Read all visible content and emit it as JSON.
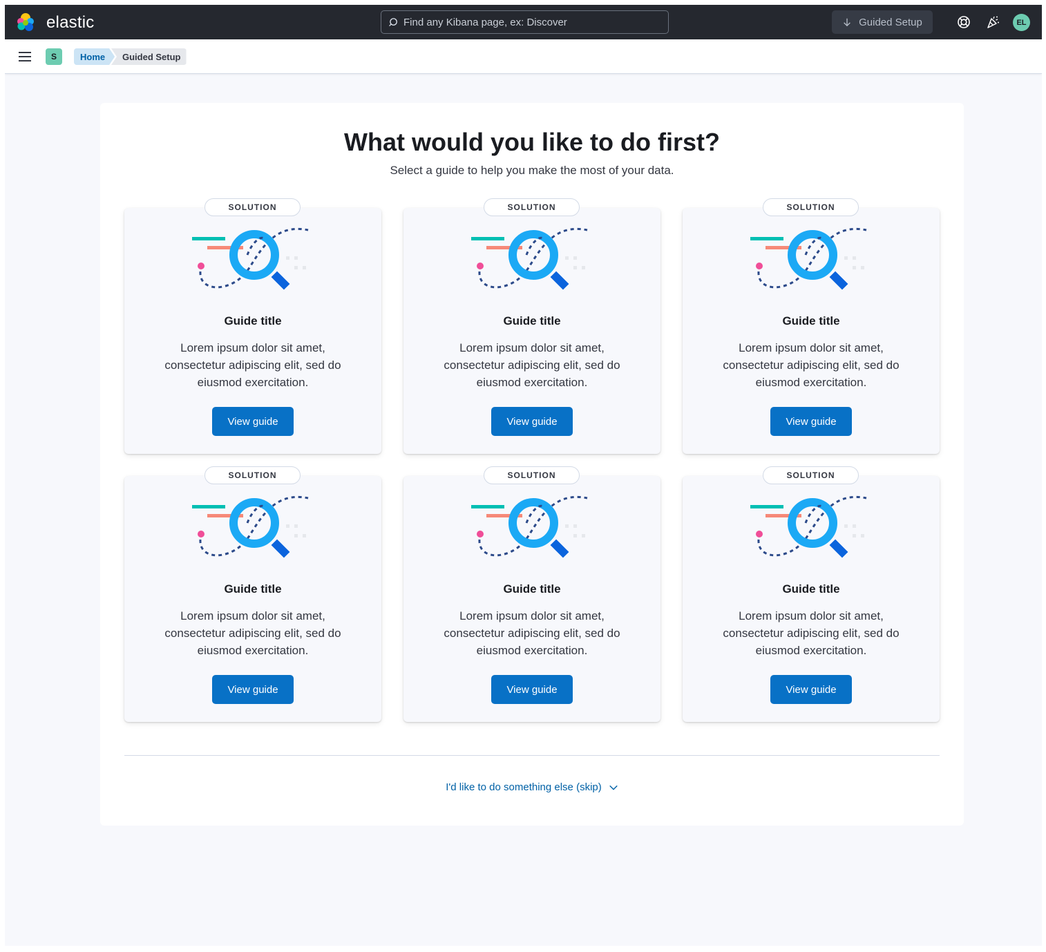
{
  "header": {
    "brand": "elastic",
    "search_placeholder": "Find any Kibana page, ex: Discover",
    "guided_setup_label": "Guided Setup",
    "avatar_initials": "EL"
  },
  "subbar": {
    "space_initial": "S",
    "breadcrumbs": [
      {
        "label": "Home"
      },
      {
        "label": "Guided Setup"
      }
    ]
  },
  "main": {
    "title": "What would you like to do first?",
    "subtitle": "Select a guide to help you make the most of your data.",
    "cards": [
      {
        "badge": "SOLUTION",
        "title": "Guide title",
        "description": "Lorem ipsum dolor sit amet, consectetur adipiscing elit, sed do eiusmod exercitation.",
        "button": "View guide"
      },
      {
        "badge": "SOLUTION",
        "title": "Guide title",
        "description": "Lorem ipsum dolor sit amet, consectetur adipiscing elit, sed do eiusmod exercitation.",
        "button": "View guide"
      },
      {
        "badge": "SOLUTION",
        "title": "Guide title",
        "description": "Lorem ipsum dolor sit amet, consectetur adipiscing elit, sed do eiusmod exercitation.",
        "button": "View guide"
      },
      {
        "badge": "SOLUTION",
        "title": "Guide title",
        "description": "Lorem ipsum dolor sit amet, consectetur adipiscing elit, sed do eiusmod exercitation.",
        "button": "View guide"
      },
      {
        "badge": "SOLUTION",
        "title": "Guide title",
        "description": "Lorem ipsum dolor sit amet, consectetur adipiscing elit, sed do eiusmod exercitation.",
        "button": "View guide"
      },
      {
        "badge": "SOLUTION",
        "title": "Guide title",
        "description": "Lorem ipsum dolor sit amet, consectetur adipiscing elit, sed do eiusmod exercitation.",
        "button": "View guide"
      }
    ],
    "skip_label": "I'd like to do something else (skip)"
  },
  "icons": {
    "logo": "elastic-logo-icon",
    "search": "search-icon",
    "guided_setup": "arrow-down-icon",
    "help": "help-lifebuoy-icon",
    "news": "newsfeed-cheer-icon",
    "menu": "hamburger-menu-icon",
    "skip": "chevron-down-icon",
    "card_illustration": "magnifier-illustration-icon"
  },
  "colors": {
    "header_bg": "#25282f",
    "accent": "#0871c6",
    "breadcrumb_home_bg": "#cce4f5",
    "avatar_bg": "#6dccb1"
  }
}
